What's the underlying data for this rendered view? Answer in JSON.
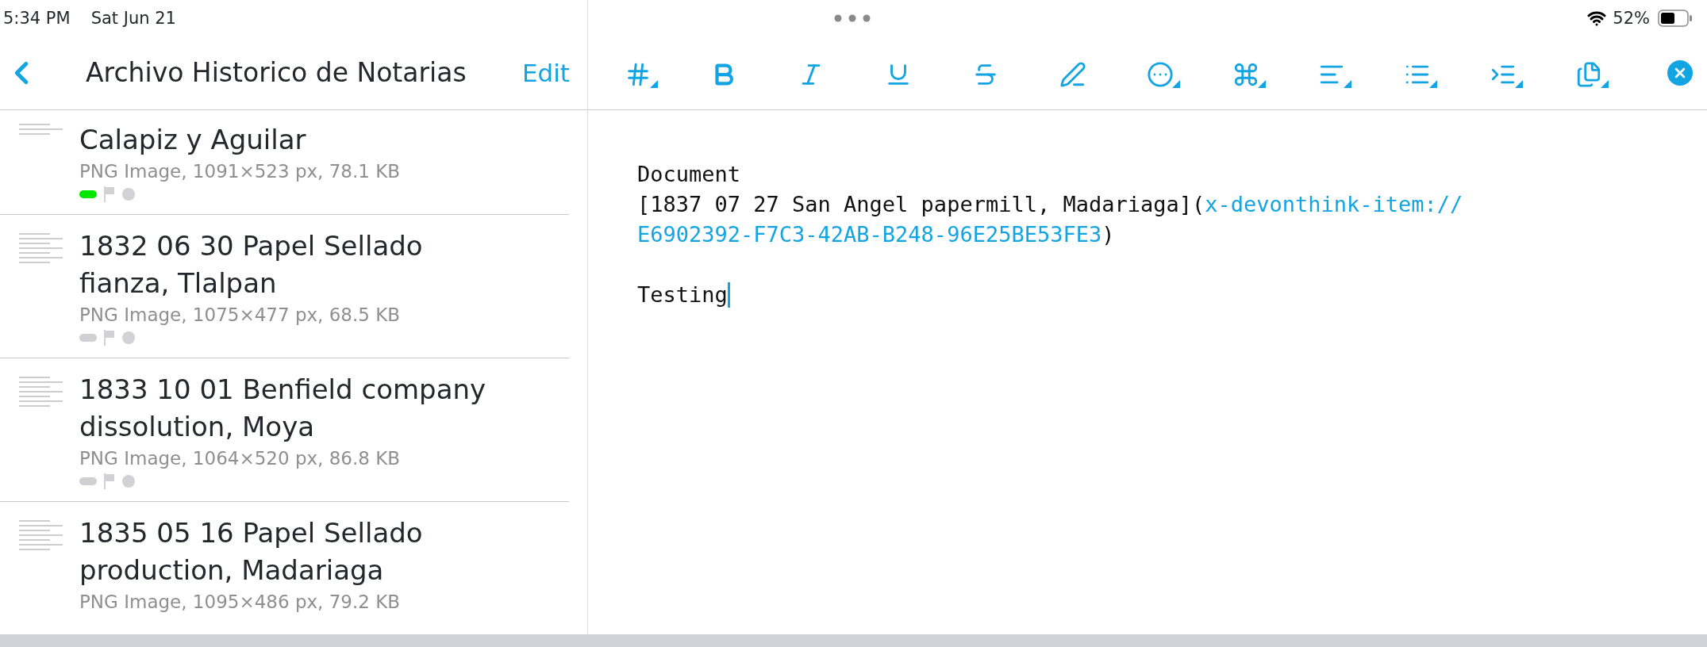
{
  "status_bar": {
    "time": "5:34 PM",
    "date": "Sat Jun 21",
    "battery": "52%"
  },
  "sidebar": {
    "title": "Archivo Historico de Notarias",
    "edit": "Edit",
    "items": [
      {
        "title": "Calapiz y Aguilar",
        "meta": "PNG Image, 1091×523 px, 78.1 KB",
        "color": "#00e600"
      },
      {
        "title": "1832 06 30 Papel Sellado fianza, Tlalpan",
        "meta": "PNG Image, 1075×477 px, 68.5 KB",
        "color": "#cfcfd4"
      },
      {
        "title": "1833 10 01 Benfield company dissolution, Moya",
        "meta": "PNG Image, 1064×520 px, 86.8 KB",
        "color": "#cfcfd4"
      },
      {
        "title": "1835 05 16 Papel Sellado production, Madariaga",
        "meta": "PNG Image, 1095×486 px, 79.2 KB"
      }
    ]
  },
  "toolbar": {
    "tools": [
      {
        "kind": "heading",
        "has_menu": true
      },
      {
        "kind": "bold",
        "has_menu": false
      },
      {
        "kind": "italic",
        "has_menu": false
      },
      {
        "kind": "underline",
        "has_menu": false
      },
      {
        "kind": "strikethrough",
        "has_menu": false
      },
      {
        "kind": "highlight",
        "has_menu": false
      },
      {
        "kind": "more",
        "has_menu": true
      },
      {
        "kind": "command",
        "has_menu": true
      },
      {
        "kind": "align",
        "has_menu": true
      },
      {
        "kind": "list",
        "has_menu": true
      },
      {
        "kind": "indent",
        "has_menu": true
      },
      {
        "kind": "clipboard",
        "has_menu": true
      }
    ]
  },
  "editor": {
    "paragraphs": [
      {
        "lines": [
          {
            "segments": [
              {
                "text": "Document",
                "link": false
              }
            ]
          },
          {
            "segments": [
              {
                "text": "[1837 07 27 San Angel papermill, Madariaga](",
                "link": false
              },
              {
                "text": "x-devonthink-item://",
                "link": true
              }
            ]
          },
          {
            "segments": [
              {
                "text": "E6902392-F7C3-42AB-B248-96E25BE53FE3",
                "link": true
              },
              {
                "text": ")",
                "link": false
              }
            ]
          }
        ]
      },
      {
        "lines": [
          {
            "cursor": true,
            "segments": [
              {
                "text": "Testing",
                "link": false
              }
            ]
          }
        ]
      }
    ]
  }
}
